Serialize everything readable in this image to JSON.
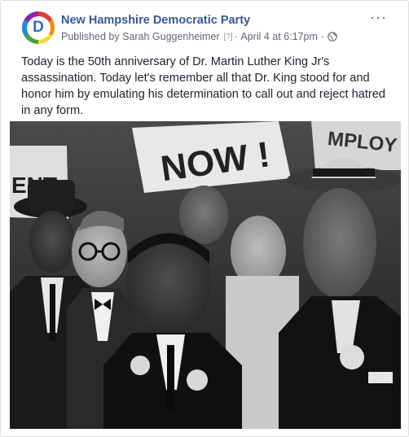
{
  "post": {
    "page_name": "New Hampshire Democratic Party",
    "published_prefix": "Published by",
    "author": "Sarah Guggenheimer",
    "author_help": "[?]",
    "separator": "·",
    "date": "April 4 at 6:17pm",
    "more_label": "···",
    "avatar_letter": "D",
    "text": "Today is the 50th anniversary of Dr. Martin Luther King Jr's assassination. Today let's remember all that Dr. King stood for and honor him by emulating his determination to call out and reject hatred in any form.",
    "photo": {
      "sign_text_main": "NOW !",
      "sign_text_left": "ENT",
      "sign_text_right": "MPLOY",
      "icon": "photo-image"
    }
  },
  "colors": {
    "page_name": "#385898",
    "meta": "#616770",
    "text": "#1d2129"
  }
}
